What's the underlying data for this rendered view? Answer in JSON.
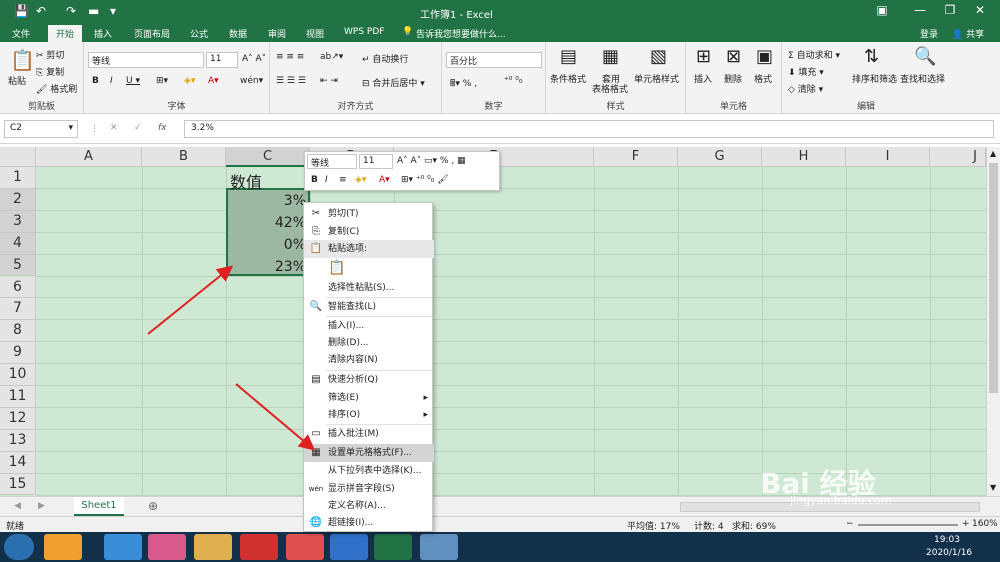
{
  "window": {
    "title": "工作簿1 - Excel",
    "login": "登录",
    "share": "共享"
  },
  "menu": {
    "tabs": [
      "文件",
      "开始",
      "插入",
      "页面布局",
      "公式",
      "数据",
      "审阅",
      "视图",
      "WPS PDF"
    ],
    "tellme": "告诉我您想要做什么..."
  },
  "ribbon": {
    "clipboard": {
      "paste": "粘贴",
      "cut": "剪切",
      "copy": "复制",
      "painter": "格式刷",
      "label": "剪贴板"
    },
    "font": {
      "name": "等线",
      "size": "11",
      "label": "字体"
    },
    "align": {
      "wrap": "自动换行",
      "merge": "合并后居中",
      "label": "对齐方式"
    },
    "number": {
      "format": "百分比",
      "label": "数字"
    },
    "styles": {
      "cond": "条件格式",
      "table1": "套用",
      "table2": "表格格式",
      "cellstyle": "单元格样式",
      "label": "样式"
    },
    "cells": {
      "insert": "插入",
      "delete": "删除",
      "format": "格式",
      "label": "单元格"
    },
    "edit": {
      "autosum": "自动求和",
      "fill": "填充",
      "clear": "清除",
      "sort": "排序和筛选",
      "find": "查找和选择",
      "label": "编辑"
    }
  },
  "formula": {
    "namebox": "C2",
    "fx": "fx",
    "value": "3.2%"
  },
  "columns": [
    "A",
    "B",
    "C",
    "D",
    "E",
    "F",
    "G",
    "H",
    "I",
    "J"
  ],
  "rows": [
    "1",
    "2",
    "3",
    "4",
    "5",
    "6",
    "7",
    "8",
    "9",
    "10",
    "11",
    "12",
    "13",
    "14",
    "15"
  ],
  "cells": {
    "c1": "数值",
    "c2": "3%",
    "c3": "42%",
    "c4": "0%",
    "c5": "23%"
  },
  "minitoolbar": {
    "font": "等线",
    "size": "11"
  },
  "context_menu": [
    "剪切(T)",
    "复制(C)",
    "粘贴选项:",
    "选择性粘贴(S)...",
    "智能查找(L)",
    "插入(I)...",
    "删除(D)...",
    "清除内容(N)",
    "快速分析(Q)",
    "筛选(E)",
    "排序(O)",
    "插入批注(M)",
    "设置单元格格式(F)...",
    "从下拉列表中选择(K)...",
    "显示拼音字段(S)",
    "定义名称(A)...",
    "超链接(I)..."
  ],
  "sheet": {
    "tab": "Sheet1",
    "ready": "就绪"
  },
  "status": {
    "avg": "平均值: 17%",
    "count": "计数: 4",
    "sum": "求和: 69%",
    "zoom": "160%"
  },
  "taskbar": {
    "time": "19:03",
    "date": "2020/1/16"
  },
  "watermark": {
    "main": "Bai 经验",
    "url": "jingyan.baidu.com"
  },
  "colors": {
    "excel_green": "#217346",
    "sheet_bg": "#cfe8d4",
    "arrow": "#e02020"
  }
}
